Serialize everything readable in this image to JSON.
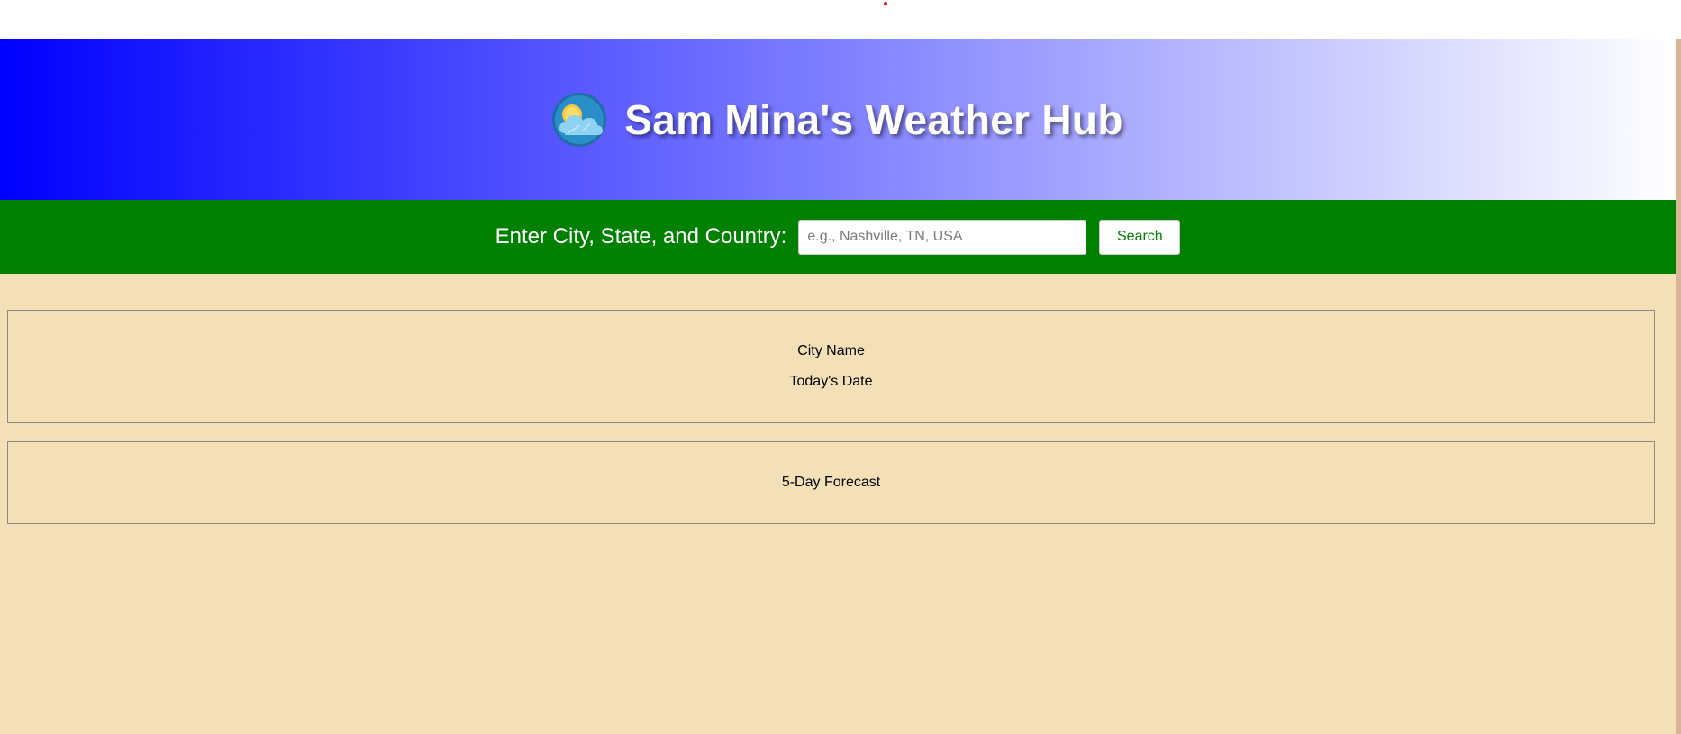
{
  "header": {
    "title": "Sam Mina's Weather Hub",
    "logo_icon": "cloud-sun-icon",
    "gradient": [
      "#0000ff",
      "#ffffff"
    ]
  },
  "search": {
    "label": "Enter City, State, and Country:",
    "placeholder": "e.g., Nashville, TN, USA",
    "value": "",
    "button_label": "Search",
    "bar_color": "#008000"
  },
  "current_weather": {
    "city_name": "City Name",
    "date": "Today's Date"
  },
  "forecast": {
    "title": "5-Day Forecast"
  },
  "colors": {
    "page_background": "#f3e0b7",
    "accent": "#008000"
  }
}
